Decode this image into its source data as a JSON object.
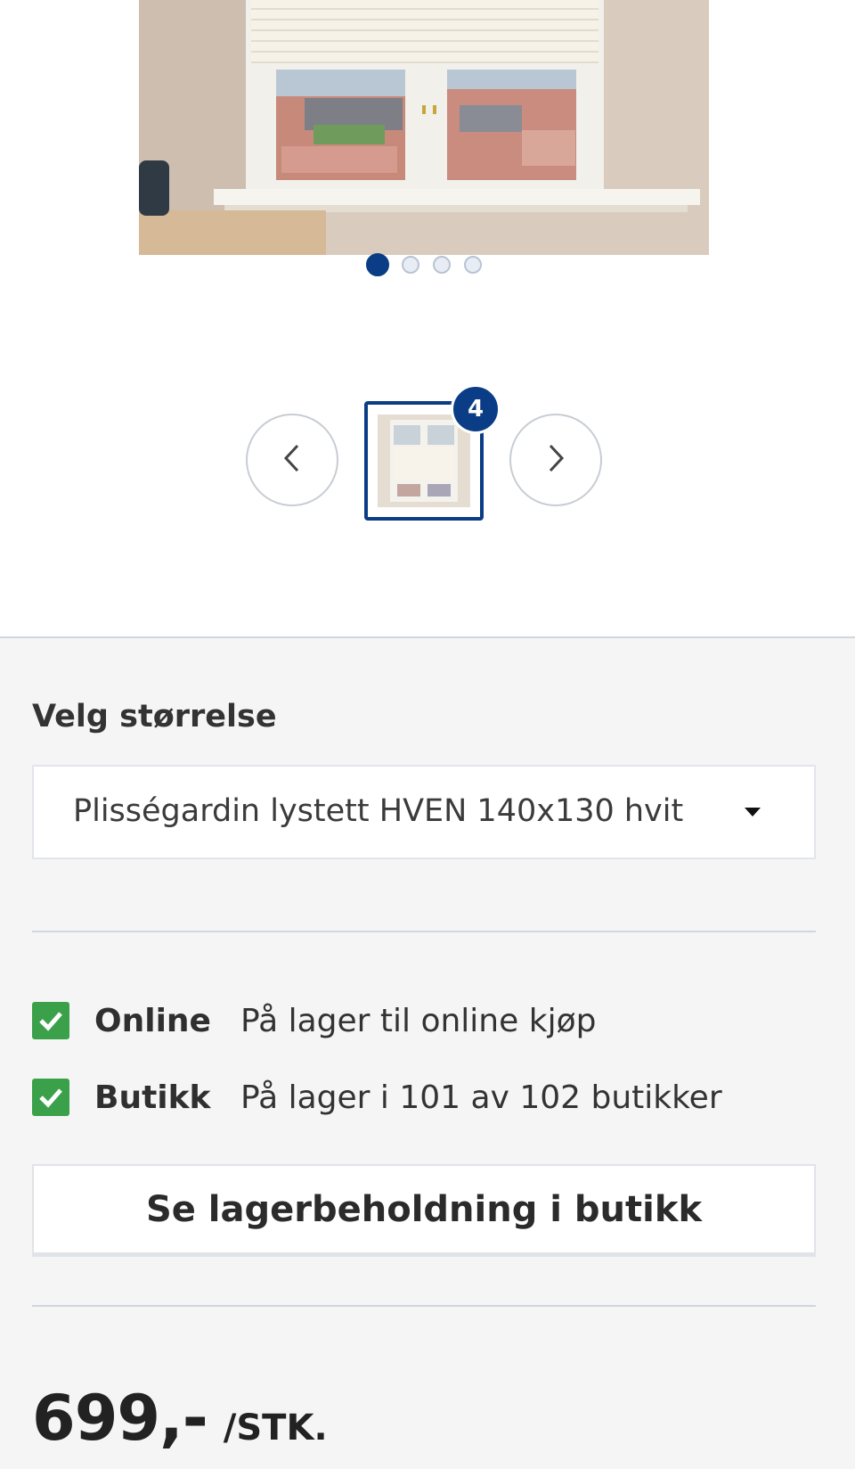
{
  "gallery": {
    "image_alt": "Plisségardin HVEN i vindu",
    "dots_count": 4,
    "active_dot": 1,
    "thumbnail_count_badge": "4"
  },
  "size_selector": {
    "label": "Velg størrelse",
    "selected_value": "Plisségardin lystett HVEN 140x130 hvit"
  },
  "availability": {
    "online": {
      "name": "Online",
      "text": "På lager til online kjøp"
    },
    "store": {
      "name": "Butikk",
      "text": "På lager i 101 av 102 butikker"
    },
    "check_color": "#3aa14a"
  },
  "stock_button": {
    "label": "Se lagerbeholdning i butikk"
  },
  "price": {
    "amount": "699,-",
    "unit": "/STK."
  },
  "colors": {
    "accent": "#0b3d86",
    "panel_bg": "#f5f5f5"
  }
}
